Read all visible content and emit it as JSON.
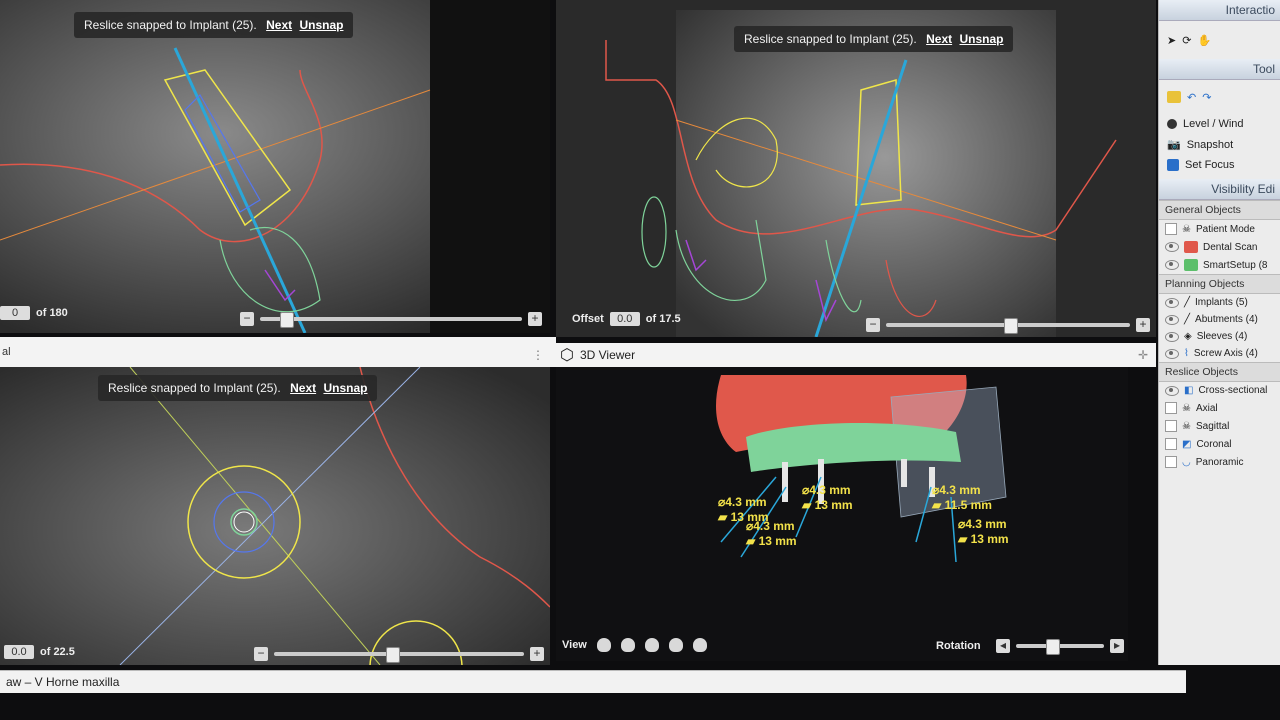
{
  "app": {
    "status_text": "aw – V Horne maxilla"
  },
  "panels": {
    "top_left": {
      "toast": {
        "text": "Reslice snapped to Implant (25).",
        "next": "Next",
        "unsnap": "Unsnap"
      },
      "slice_value": "0",
      "slice_total": "of 180"
    },
    "top_right": {
      "toast": {
        "text": "Reslice snapped to Implant (25).",
        "next": "Next",
        "unsnap": "Unsnap"
      },
      "offset_label": "Offset",
      "offset_value": "0.0",
      "offset_total": "of 17.5"
    },
    "bottom_left": {
      "title_fragment": "al",
      "toast": {
        "text": "Reslice snapped to Implant (25).",
        "next": "Next",
        "unsnap": "Unsnap"
      },
      "slice_value": "0.0",
      "slice_total": "of 22.5"
    },
    "viewer_3d": {
      "title": "3D Viewer",
      "measurements": [
        {
          "diam": "4.3 mm",
          "len": "13 mm"
        },
        {
          "diam": "4.3 mm",
          "len": "13 mm"
        },
        {
          "diam": "4.3 mm",
          "len": "13 mm"
        },
        {
          "diam": "4.3 mm",
          "len": "11.5 mm"
        },
        {
          "diam": "4.3 mm",
          "len": "13 mm"
        }
      ],
      "view_label": "View",
      "rotation_label": "Rotation"
    }
  },
  "right_panel": {
    "interaction_header": "Interactio",
    "tools_header": "Tool",
    "level_window": "Level / Wind",
    "snapshot": "Snapshot",
    "set_focus": "Set Focus",
    "visibility_header": "Visibility Edi",
    "general_objects": "General Objects",
    "general_items": [
      "Patient Mode",
      "Dental Scan",
      "SmartSetup (8"
    ],
    "planning_objects": "Planning Objects",
    "planning_items": [
      "Implants (5)",
      "Abutments (4)",
      "Sleeves (4)",
      "Screw Axis (4)"
    ],
    "reslice_objects": "Reslice Objects",
    "reslice_items": [
      "Cross-sectional",
      "Axial",
      "Sagittal",
      "Coronal",
      "Panoramic"
    ]
  },
  "colors": {
    "implant_blue": "#2aa7d9",
    "outline_yellow": "#f0e64a",
    "bone_red": "#e0574a",
    "crown_green": "#7fd39a",
    "gum_red": "#e0584b"
  }
}
